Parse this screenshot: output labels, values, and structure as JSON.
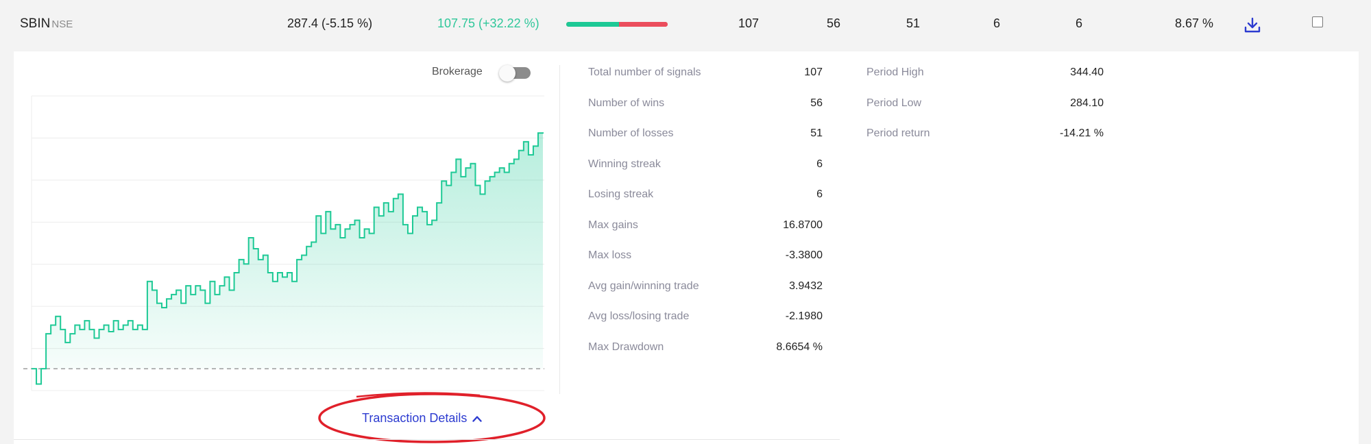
{
  "row": {
    "symbol": "SBIN",
    "exchange": "NSE",
    "ltp_change": "287.4 (-5.15 %)",
    "returns": "107.75 (+32.22 %)",
    "win_fraction": 0.523,
    "signals": "107",
    "wins": "56",
    "losses": "51",
    "winning_streak": "6",
    "losing_streak": "6",
    "max_drawdown": "8.67 %",
    "download_icon": "download-icon",
    "checkbox_checked": false
  },
  "colors": {
    "positive": "#2fc79a",
    "win_bar": "#1dc995",
    "loss_bar": "#eb4d5c",
    "link": "#2c3bd0",
    "annotation": "#e0202a"
  },
  "panel": {
    "brokerage_label": "Brokerage",
    "brokerage_enabled": false,
    "transaction_link": "Transaction Details",
    "transaction_icon": "chevron-up-icon"
  },
  "stats_left": [
    {
      "label": "Total number of signals",
      "value": "107"
    },
    {
      "label": "Number of wins",
      "value": "56"
    },
    {
      "label": "Number of losses",
      "value": "51"
    },
    {
      "label": "Winning streak",
      "value": "6"
    },
    {
      "label": "Losing streak",
      "value": "6"
    },
    {
      "label": "Max gains",
      "value": "16.8700"
    },
    {
      "label": "Max loss",
      "value": "-3.3800"
    },
    {
      "label": "Avg gain/winning trade",
      "value": "3.9432"
    },
    {
      "label": "Avg loss/losing trade",
      "value": "-2.1980"
    },
    {
      "label": "Max Drawdown",
      "value": "8.6654 %"
    }
  ],
  "stats_right": [
    {
      "label": "Period High",
      "value": "344.40"
    },
    {
      "label": "Period Low",
      "value": "284.10"
    },
    {
      "label": "Period return",
      "value": "-14.21 %"
    }
  ],
  "chart_data": {
    "type": "area",
    "grid": true,
    "baseline": 0,
    "ylim": [
      -10,
      125
    ],
    "x": [
      0,
      1,
      2,
      3,
      4,
      5,
      6,
      7,
      8,
      9,
      10,
      11,
      12,
      13,
      14,
      15,
      16,
      17,
      18,
      19,
      20,
      21,
      22,
      23,
      24,
      25,
      26,
      27,
      28,
      29,
      30,
      31,
      32,
      33,
      34,
      35,
      36,
      37,
      38,
      39,
      40,
      41,
      42,
      43,
      44,
      45,
      46,
      47,
      48,
      49,
      50,
      51,
      52,
      53,
      54,
      55,
      56,
      57,
      58,
      59,
      60,
      61,
      62,
      63,
      64,
      65,
      66,
      67,
      68,
      69,
      70,
      71,
      72,
      73,
      74,
      75,
      76,
      77,
      78,
      79,
      80,
      81,
      82,
      83,
      84,
      85,
      86,
      87,
      88,
      89,
      90,
      91,
      92,
      93,
      94,
      95,
      96,
      97,
      98,
      99,
      100,
      101,
      102,
      103,
      104,
      105,
      106
    ],
    "y": [
      0,
      -7,
      0,
      16,
      20,
      24,
      18,
      12,
      16,
      20,
      18,
      22,
      18,
      14,
      18,
      20,
      17,
      22,
      18,
      20,
      22,
      18,
      20,
      18,
      40,
      36,
      30,
      28,
      32,
      34,
      36,
      30,
      38,
      34,
      38,
      36,
      30,
      40,
      34,
      38,
      42,
      36,
      44,
      50,
      48,
      60,
      55,
      50,
      52,
      44,
      40,
      44,
      42,
      44,
      40,
      50,
      52,
      56,
      58,
      70,
      62,
      72,
      64,
      66,
      60,
      64,
      66,
      68,
      60,
      64,
      62,
      74,
      70,
      76,
      72,
      78,
      80,
      66,
      62,
      70,
      74,
      72,
      66,
      68,
      76,
      86,
      84,
      90,
      96,
      88,
      92,
      94,
      84,
      80,
      86,
      88,
      90,
      92,
      90,
      94,
      96,
      100,
      104,
      98,
      102,
      108,
      107.75
    ]
  }
}
